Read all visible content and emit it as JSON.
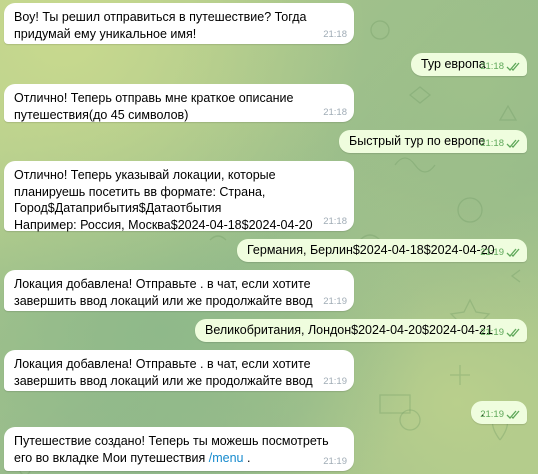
{
  "messages": [
    {
      "id": 1,
      "side": "in",
      "text": "Воу! Ты решил отправиться в путешествие? Тогда придумай ему уникальное имя!",
      "time": "21:18"
    },
    {
      "id": 2,
      "side": "out",
      "text": "Тур европа",
      "time": "21:18",
      "read": true
    },
    {
      "id": 3,
      "side": "in",
      "text": "Отлично! Теперь отправь мне краткое описание путешествия(до 45 символов)",
      "time": "21:18"
    },
    {
      "id": 4,
      "side": "out",
      "text": "Быстрый тур по европе",
      "time": "21:18",
      "read": true
    },
    {
      "id": 5,
      "side": "in",
      "text": "Отлично! Теперь указывай локации, которые планируешь посетить вв формате: Страна, Город$Датаприбытия$Датаотбытия\nНапример: Россия, Москва$2024-04-18$2024-04-20",
      "time": "21:18"
    },
    {
      "id": 6,
      "side": "out",
      "text": "Германия, Берлин$2024-04-18$2024-04-20",
      "time": "21:19",
      "read": true
    },
    {
      "id": 7,
      "side": "in",
      "text": "Локация добавлена! Отправьте . в чат, если хотите завершить ввод локаций или же продолжайте ввод",
      "time": "21:19"
    },
    {
      "id": 8,
      "side": "out",
      "text": "Великобритания, Лондон$2024-04-20$2024-04-21",
      "time": "21:19",
      "read": true
    },
    {
      "id": 9,
      "side": "in",
      "text": "Локация добавлена! Отправьте . в чат, если хотите завершить ввод локаций или же продолжайте ввод",
      "time": "21:19"
    },
    {
      "id": 10,
      "side": "out",
      "text": ".",
      "time": "21:19",
      "read": true
    },
    {
      "id": 11,
      "side": "in",
      "text_before_link": "Путешествие создано! Теперь ты можешь посмотреть его во вкладке Мои путешествия ",
      "link": "/menu",
      "text_after_link": " .",
      "time": "21:19"
    }
  ],
  "colors": {
    "incoming_bubble": "#ffffff",
    "outgoing_bubble": "#effdde",
    "outgoing_time": "#5fa85a",
    "incoming_time": "#a0acb6",
    "link": "#168acd"
  },
  "icons": {
    "read_status": "double-check-icon"
  }
}
